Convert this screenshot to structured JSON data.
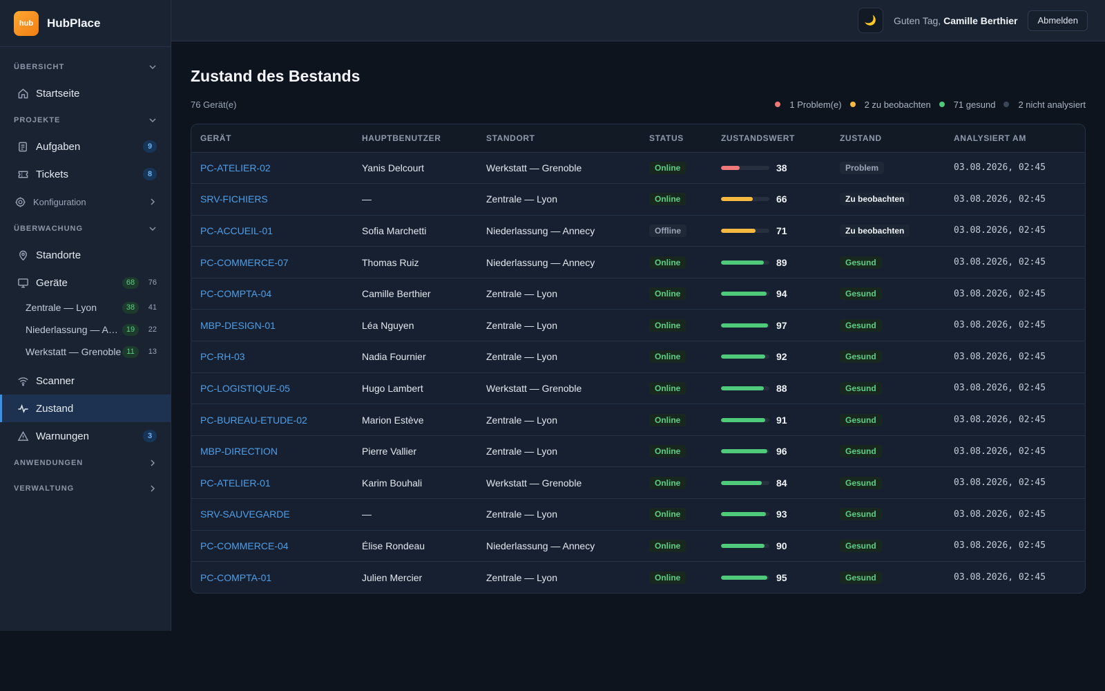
{
  "app": {
    "logo_text": "hub",
    "name": "HubPlace"
  },
  "colors": {
    "accent": "#3d8fe0",
    "problem": "#f07878",
    "watch": "#f5b942",
    "healthy": "#4fc97a",
    "unanalyzed": "#3b4657",
    "brand": "#f59222"
  },
  "sidebar": {
    "sec_overview": "ÜBERSICHT",
    "home": "Startseite",
    "sec_projects": "PROJEKTE",
    "tasks": "Aufgaben",
    "tasks_count": "9",
    "tickets": "Tickets",
    "tickets_count": "8",
    "config": "Konfiguration",
    "sec_monitoring": "ÜBERWACHUNG",
    "locations": "Standorte",
    "devices": "Geräte",
    "devices_online": "68",
    "devices_total": "76",
    "subs": [
      {
        "label": "Zentrale — Lyon",
        "online": "38",
        "total": "41"
      },
      {
        "label": "Niederlassung — Annecy",
        "online": "19",
        "total": "22"
      },
      {
        "label": "Werkstatt — Grenoble",
        "online": "11",
        "total": "13"
      }
    ],
    "scanner": "Scanner",
    "health": "Zustand",
    "warnings": "Warnungen",
    "warnings_count": "3",
    "sec_apps": "ANWENDUNGEN",
    "sec_admin": "VERWALTUNG"
  },
  "topbar": {
    "theme_icon": "moon-icon",
    "greeting": "Guten Tag, ",
    "user": "Camille Berthier",
    "logout": "Abmelden"
  },
  "page": {
    "title": "Zustand des Bestands",
    "count": "76 Gerät(e)",
    "legend": [
      {
        "label": "1 Problem(e)",
        "color": "#f07878"
      },
      {
        "label": "2 zu beobachten",
        "color": "#f5b942"
      },
      {
        "label": "71 gesund",
        "color": "#4fc97a"
      },
      {
        "label": "2 nicht analysiert",
        "color": "#3b4657"
      }
    ]
  },
  "table": {
    "headers": [
      "GERÄT",
      "HAUPTBENUTZER",
      "STANDORT",
      "STATUS",
      "ZUSTANDSWERT",
      "ZUSTAND",
      "ANALYSIERT AM"
    ],
    "rows": [
      {
        "device": "PC-ATELIER-02",
        "user": "Yanis Delcourt",
        "location": "Werkstatt — Grenoble",
        "status": "Online",
        "score": 38,
        "condition": "Problem",
        "analyzed": "03.08.2026, 02:45"
      },
      {
        "device": "SRV-FICHIERS",
        "user": "—",
        "location": "Zentrale — Lyon",
        "status": "Online",
        "score": 66,
        "condition": "Zu beobachten",
        "analyzed": "03.08.2026, 02:45"
      },
      {
        "device": "PC-ACCUEIL-01",
        "user": "Sofia Marchetti",
        "location": "Niederlassung — Annecy",
        "status": "Offline",
        "score": 71,
        "condition": "Zu beobachten",
        "analyzed": "03.08.2026, 02:45"
      },
      {
        "device": "PC-COMMERCE-07",
        "user": "Thomas Ruiz",
        "location": "Niederlassung — Annecy",
        "status": "Online",
        "score": 89,
        "condition": "Gesund",
        "analyzed": "03.08.2026, 02:45"
      },
      {
        "device": "PC-COMPTA-04",
        "user": "Camille Berthier",
        "location": "Zentrale — Lyon",
        "status": "Online",
        "score": 94,
        "condition": "Gesund",
        "analyzed": "03.08.2026, 02:45"
      },
      {
        "device": "MBP-DESIGN-01",
        "user": "Léa Nguyen",
        "location": "Zentrale — Lyon",
        "status": "Online",
        "score": 97,
        "condition": "Gesund",
        "analyzed": "03.08.2026, 02:45"
      },
      {
        "device": "PC-RH-03",
        "user": "Nadia Fournier",
        "location": "Zentrale — Lyon",
        "status": "Online",
        "score": 92,
        "condition": "Gesund",
        "analyzed": "03.08.2026, 02:45"
      },
      {
        "device": "PC-LOGISTIQUE-05",
        "user": "Hugo Lambert",
        "location": "Werkstatt — Grenoble",
        "status": "Online",
        "score": 88,
        "condition": "Gesund",
        "analyzed": "03.08.2026, 02:45"
      },
      {
        "device": "PC-BUREAU-ETUDE-02",
        "user": "Marion Estève",
        "location": "Zentrale — Lyon",
        "status": "Online",
        "score": 91,
        "condition": "Gesund",
        "analyzed": "03.08.2026, 02:45"
      },
      {
        "device": "MBP-DIRECTION",
        "user": "Pierre Vallier",
        "location": "Zentrale — Lyon",
        "status": "Online",
        "score": 96,
        "condition": "Gesund",
        "analyzed": "03.08.2026, 02:45"
      },
      {
        "device": "PC-ATELIER-01",
        "user": "Karim Bouhali",
        "location": "Werkstatt — Grenoble",
        "status": "Online",
        "score": 84,
        "condition": "Gesund",
        "analyzed": "03.08.2026, 02:45"
      },
      {
        "device": "SRV-SAUVEGARDE",
        "user": "—",
        "location": "Zentrale — Lyon",
        "status": "Online",
        "score": 93,
        "condition": "Gesund",
        "analyzed": "03.08.2026, 02:45"
      },
      {
        "device": "PC-COMMERCE-04",
        "user": "Élise Rondeau",
        "location": "Niederlassung — Annecy",
        "status": "Online",
        "score": 90,
        "condition": "Gesund",
        "analyzed": "03.08.2026, 02:45"
      },
      {
        "device": "PC-COMPTA-01",
        "user": "Julien Mercier",
        "location": "Zentrale — Lyon",
        "status": "Online",
        "score": 95,
        "condition": "Gesund",
        "analyzed": "03.08.2026, 02:45"
      }
    ]
  }
}
